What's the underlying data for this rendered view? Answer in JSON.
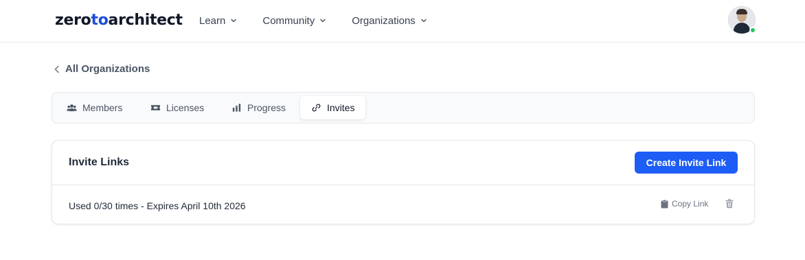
{
  "brand": {
    "part1": "zero",
    "part2": "to",
    "part3": "architect",
    "accent_color": "#1d4ed8"
  },
  "nav": [
    {
      "label": "Learn"
    },
    {
      "label": "Community"
    },
    {
      "label": "Organizations"
    }
  ],
  "user": {
    "status": "online",
    "status_color": "#22c55e"
  },
  "back_link": {
    "label": "All Organizations"
  },
  "tabs": [
    {
      "label": "Members",
      "icon": "users-icon"
    },
    {
      "label": "Licenses",
      "icon": "ticket-icon"
    },
    {
      "label": "Progress",
      "icon": "bar-chart-icon"
    },
    {
      "label": "Invites",
      "icon": "link-icon",
      "active": true
    }
  ],
  "invite_card": {
    "title": "Invite Links",
    "create_button": "Create Invite Link",
    "button_color": "#1d5cf5",
    "links": [
      {
        "usage": "Used 0/30 times - Expires April 10th 2026",
        "copy_label": "Copy Link"
      }
    ]
  }
}
